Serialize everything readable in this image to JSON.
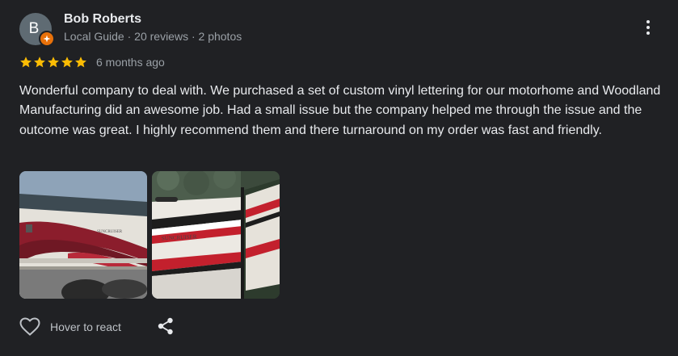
{
  "author": {
    "initial": "B",
    "name": "Bob Roberts",
    "meta": "Local Guide · 20 reviews · 2 photos",
    "avatar_color": "#5f6b73",
    "badge_color": "#e8710a"
  },
  "review": {
    "rating": 5,
    "max_rating": 5,
    "star_color": "#fbbc04",
    "date": "6 months ago",
    "text": "Wonderful company to deal with. We purchased a set of custom vinyl lettering for our motorhome and Woodland Manufacturing did an awesome job. Had a small issue but the company helped me through the issue and the outcome was great. I highly recommend them and there turnaround on my order was fast and friendly.",
    "photos": [
      {
        "id": "photo-1",
        "lettering": "SUNCRUISER"
      },
      {
        "id": "photo-2",
        "lettering": "SUNCRUISER"
      }
    ]
  },
  "actions": {
    "react_label": "Hover to react",
    "react_icon": "heart-outline-icon",
    "share_icon": "share-icon",
    "more_icon": "more-vert-icon"
  }
}
